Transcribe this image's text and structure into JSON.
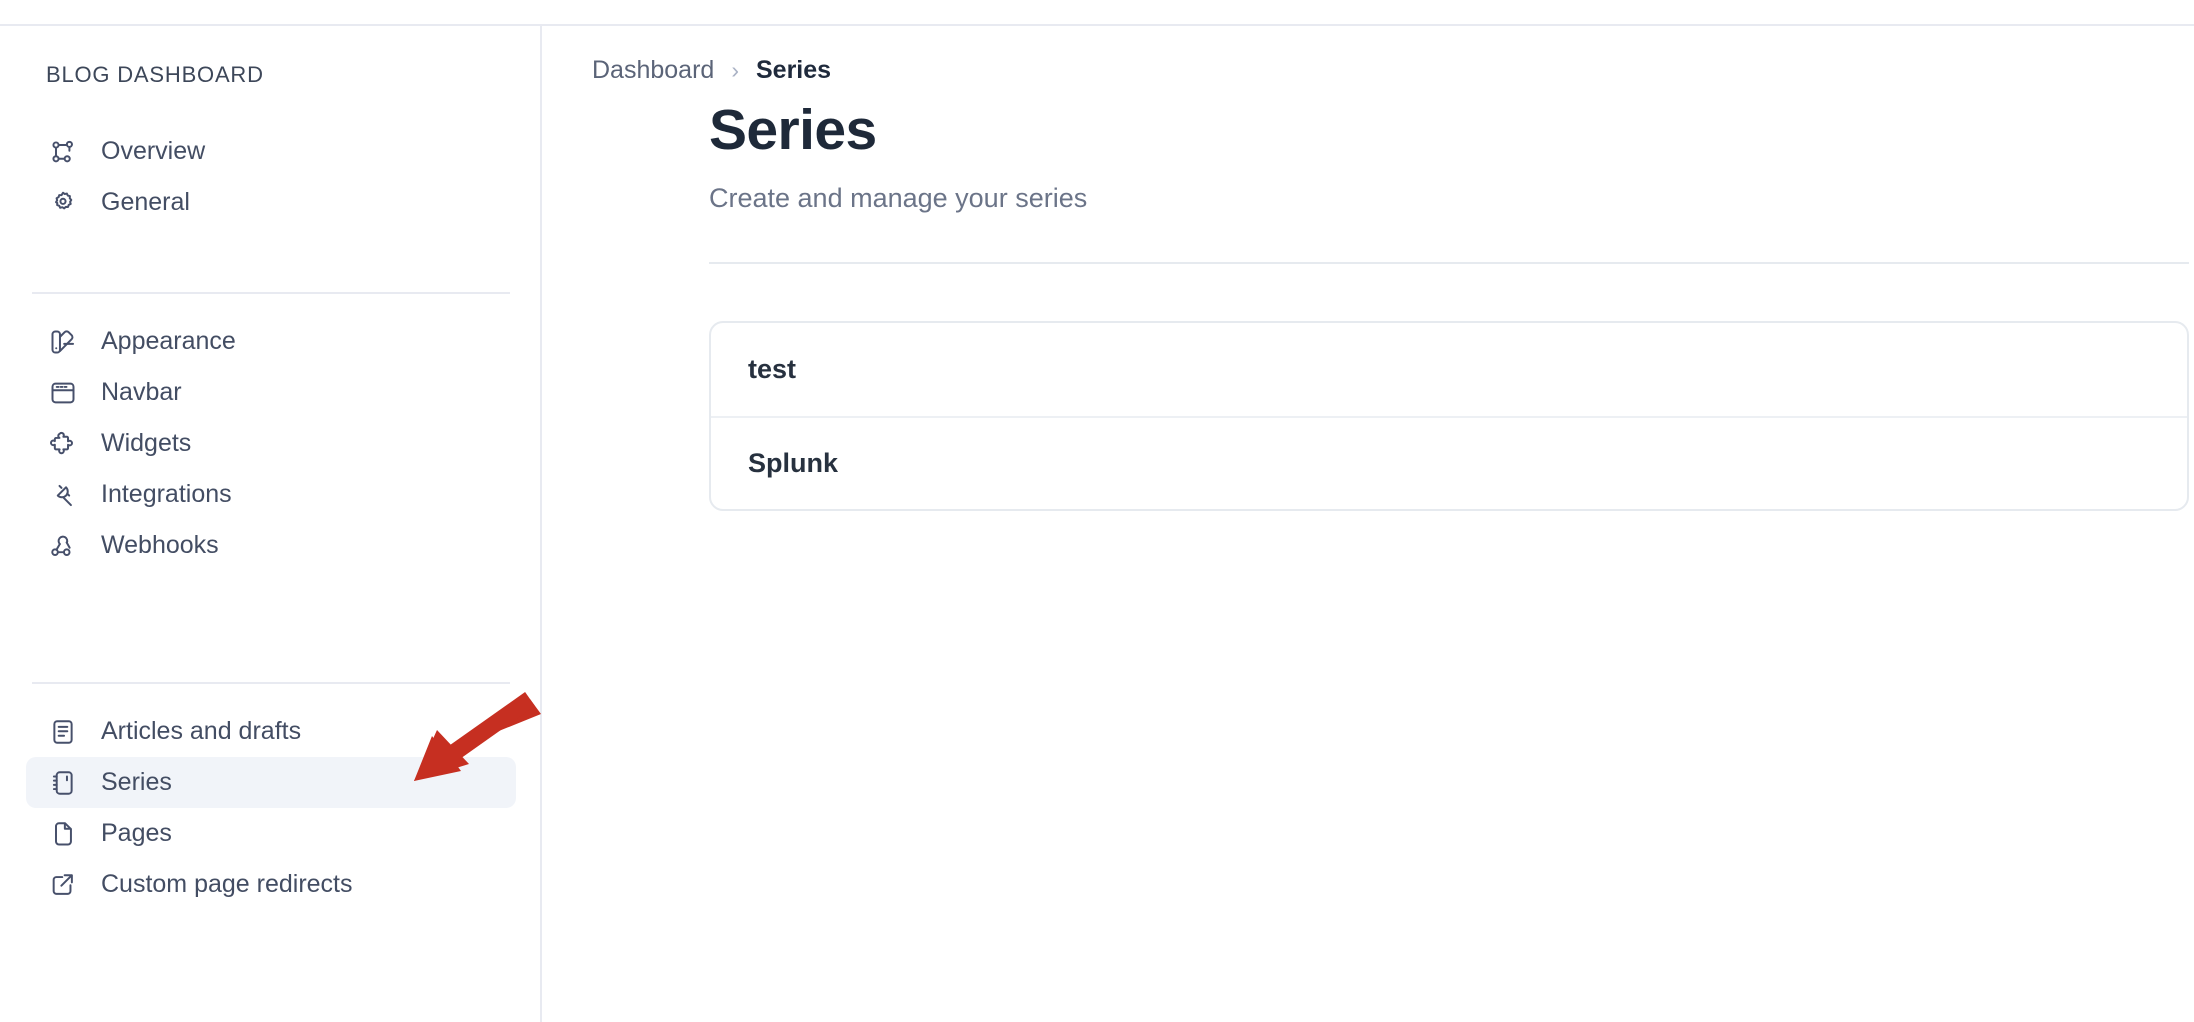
{
  "sidebar": {
    "title": "BLOG DASHBOARD",
    "groups": [
      {
        "name": "primary",
        "items": [
          {
            "label": "Overview",
            "icon": "nodes-icon",
            "active": false
          },
          {
            "label": "General",
            "icon": "gear-icon",
            "active": false
          }
        ]
      },
      {
        "name": "customization",
        "items": [
          {
            "label": "Appearance",
            "icon": "palette-icon",
            "active": false
          },
          {
            "label": "Navbar",
            "icon": "browser-window-icon",
            "active": false
          },
          {
            "label": "Widgets",
            "icon": "puzzle-piece-icon",
            "active": false
          },
          {
            "label": "Integrations",
            "icon": "plug-icon",
            "active": false
          },
          {
            "label": "Webhooks",
            "icon": "webhook-icon",
            "active": false
          }
        ]
      },
      {
        "name": "content",
        "items": [
          {
            "label": "Articles and drafts",
            "icon": "document-lines-icon",
            "active": false
          },
          {
            "label": "Series",
            "icon": "series-book-icon",
            "active": true
          },
          {
            "label": "Pages",
            "icon": "page-icon",
            "active": false
          },
          {
            "label": "Custom page redirects",
            "icon": "external-link-icon",
            "active": false
          }
        ]
      }
    ]
  },
  "breadcrumb": {
    "root": "Dashboard",
    "separator": "›",
    "current": "Series"
  },
  "page": {
    "title": "Series",
    "subtitle": "Create and manage your series"
  },
  "series_list": {
    "items": [
      {
        "name": "test"
      },
      {
        "name": "Splunk"
      }
    ]
  },
  "annotation": {
    "arrow_color": "#c62f21",
    "arrow_name": "red-pointer-arrow"
  },
  "colors": {
    "active_nav_background": "#f1f4f9",
    "border": "#e8eaf1",
    "text_primary": "#1e2939",
    "text_muted": "#6b7488"
  }
}
